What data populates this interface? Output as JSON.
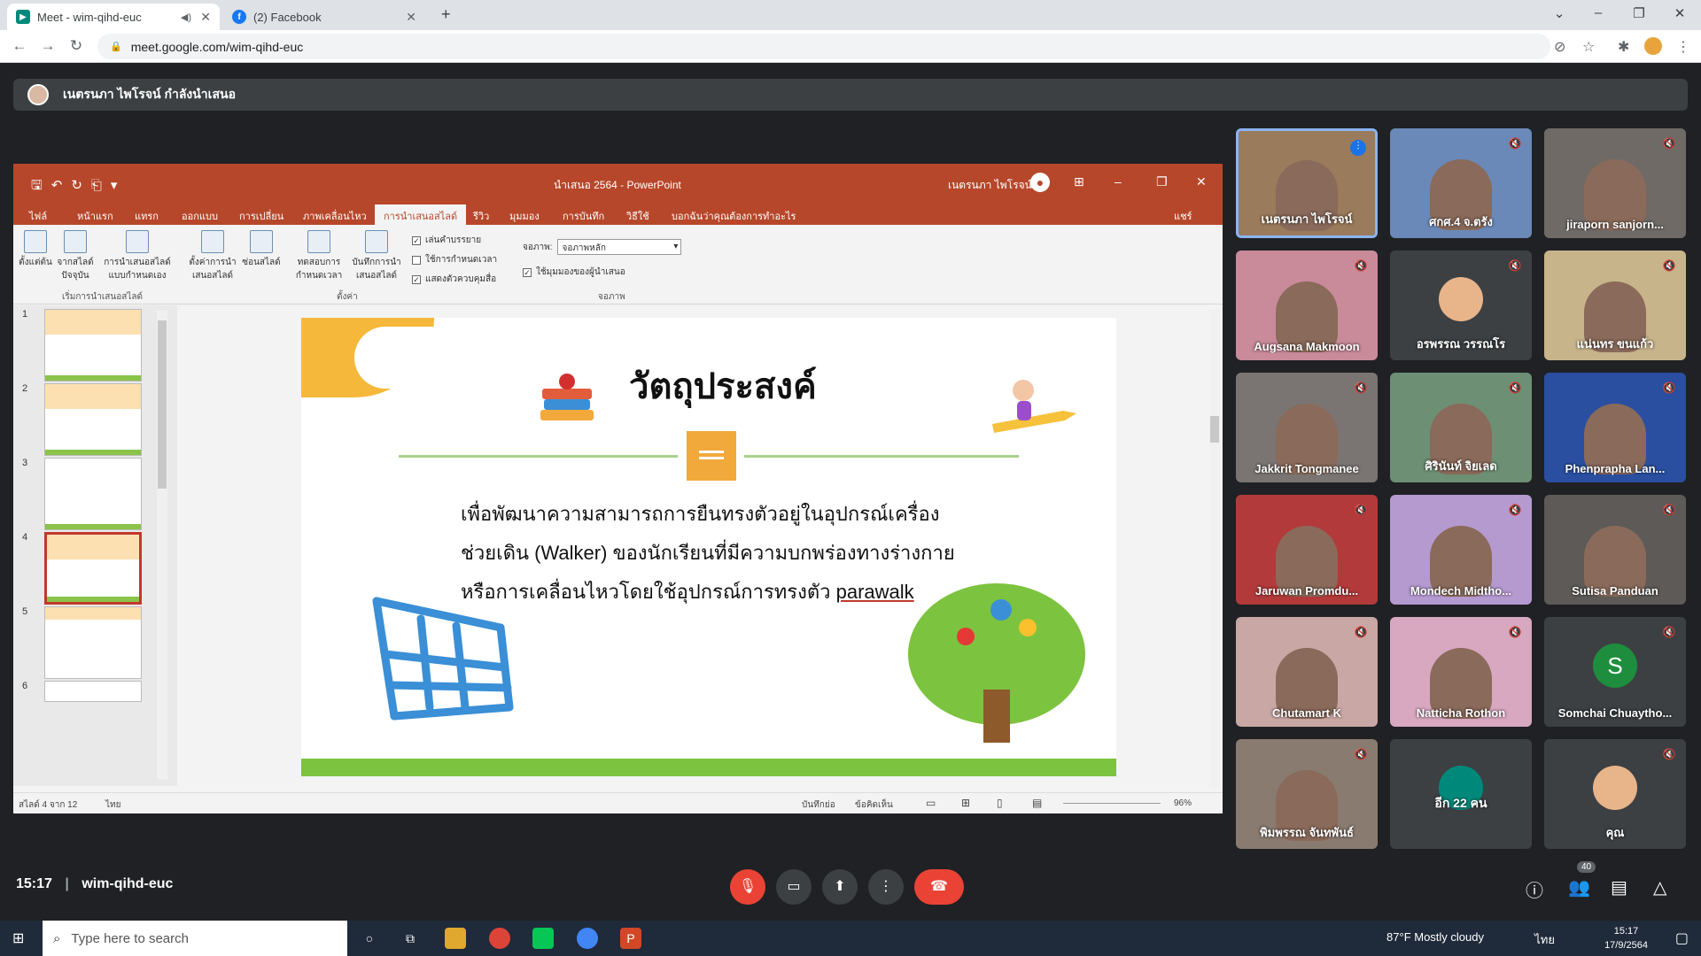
{
  "browser": {
    "tabs": [
      {
        "label": "Meet - wim-qihd-euc",
        "active": true
      },
      {
        "label": "(2) Facebook",
        "active": false
      }
    ],
    "url": "meet.google.com/wim-qihd-euc"
  },
  "presenting_banner": "เนตรนภา ไพโรจน์ กำลังนำเสนอ",
  "powerpoint": {
    "doc_title": "นำเสนอ 2564 - PowerPoint",
    "user_name": "เนตรนภา ไพโรจน์",
    "share_label": "แชร์",
    "tabs": [
      "ไฟล์",
      "หน้าแรก",
      "แทรก",
      "ออกแบบ",
      "การเปลี่ยน",
      "ภาพเคลื่อนไหว",
      "การนำเสนอสไลด์",
      "รีวิว",
      "มุมมอง",
      "การบันทึก",
      "วิธีใช้",
      "บอกฉันว่าคุณต้องการทำอะไร"
    ],
    "ribbon": {
      "b1": "ตั้งแต่ต้น",
      "b2": "จากสไลด์ปัจจุบัน",
      "b3": "การนำเสนอสไลด์แบบกำหนดเอง",
      "b4": "ตั้งค่าการนำเสนอสไลด์",
      "b5": "ซ่อนสไลด์",
      "b6": "ทดสอบการกำหนดเวลา",
      "b7": "บันทึกการนำเสนอสไลด์",
      "g1": "เริ่มการนำเสนอสไลด์",
      "g2": "ตั้งค่า",
      "g3": "จอภาพ",
      "c1": "เล่นคำบรรยาย",
      "c2": "ใช้การกำหนดเวลา",
      "c3": "แสดงตัวควบคุมสื่อ",
      "monitor_label": "จอภาพ:",
      "monitor_value": "จอภาพหลัก",
      "presenter_view": "ใช้มุมมองของผู้นำเสนอ"
    },
    "slide_numbers": [
      "1",
      "2",
      "3",
      "4",
      "5",
      "6"
    ],
    "slide": {
      "title": "วัตถุประสงค์",
      "body_1": "เพื่อพัฒนาความสามารถการยืนทรงตัวอยู่ในอุปกรณ์เครื่องช่วยเดิน (Walker) ของนักเรียนที่มีความบกพร่องทางร่างกายหรือการเคลื่อนไหวโดยใช้อุปกรณ์การทรงตัว",
      "body_ul": "parawalk"
    },
    "status": {
      "slide_pos": "สไลด์ 4 จาก 12",
      "lang": "ไทย",
      "notes": "บันทึกย่อ",
      "comments": "ข้อคิดเห็น",
      "zoom": "96%"
    }
  },
  "participants": [
    {
      "name": "เนตรนภา ไพโรจน์",
      "bg": "#9a7b5c",
      "speaking": true
    },
    {
      "name": "ศกศ.4 จ.ตรัง",
      "bg": "#6a89b8",
      "muted": true
    },
    {
      "name": "jiraporn sanjorn...",
      "bg": "#6f6a66",
      "muted": true
    },
    {
      "name": "Augsana Makmoon",
      "bg": "#c98a9a",
      "muted": true
    },
    {
      "name": "อรพรรณ วรรณโร",
      "bg": "#3c4043",
      "muted": true,
      "avatar": true
    },
    {
      "name": "แน่นทร ขนแก้ว",
      "bg": "#c8b48a",
      "muted": true
    },
    {
      "name": "Jakkrit Tongmanee",
      "bg": "#7a7572",
      "muted": true
    },
    {
      "name": "ศิรินันท์ จิยเลด",
      "bg": "#6d8f74",
      "muted": true
    },
    {
      "name": "Phenprapha Lan...",
      "bg": "#2a4fa0",
      "muted": true
    },
    {
      "name": "Jaruwan Promdu...",
      "bg": "#b23a3a",
      "muted": true
    },
    {
      "name": "Mondech Midtho...",
      "bg": "#b59ad0",
      "muted": true
    },
    {
      "name": "Sutisa Panduan",
      "bg": "#5d5a57",
      "muted": true
    },
    {
      "name": "Chutamart K",
      "bg": "#c9a7a4",
      "muted": true
    },
    {
      "name": "Natticha Rothon",
      "bg": "#d8a7c0",
      "muted": true
    },
    {
      "name": "Somchai Chuaytho...",
      "bg": "#3c4043",
      "muted": true,
      "letter": "S"
    },
    {
      "name": "พิมพรรณ จันทพันธ์",
      "bg": "#8a7b70",
      "muted": true
    },
    {
      "name": "อีก 22 คน",
      "bg": "#3c4043"
    },
    {
      "name": "คุณ",
      "bg": "#3c4043",
      "muted": true,
      "avatar": true
    }
  ],
  "meeting": {
    "time": "15:17",
    "code": "wim-qihd-euc",
    "participant_count": "40"
  },
  "taskbar": {
    "search_placeholder": "Type here to search",
    "weather": "87°F  Mostly cloudy",
    "lang": "ไทย",
    "time": "15:17",
    "date": "17/9/2564"
  },
  "icons": [
    "search-icon",
    "mic-off-icon",
    "camera-icon",
    "present-icon",
    "more-icon",
    "end-call-icon",
    "info-icon",
    "people-icon",
    "chat-icon",
    "activities-icon"
  ],
  "colors": {
    "ppt_accent": "#b7472a",
    "meet_bg": "#202124",
    "end_call": "#ea4335",
    "active_speaker_border": "#8ab4f8"
  }
}
